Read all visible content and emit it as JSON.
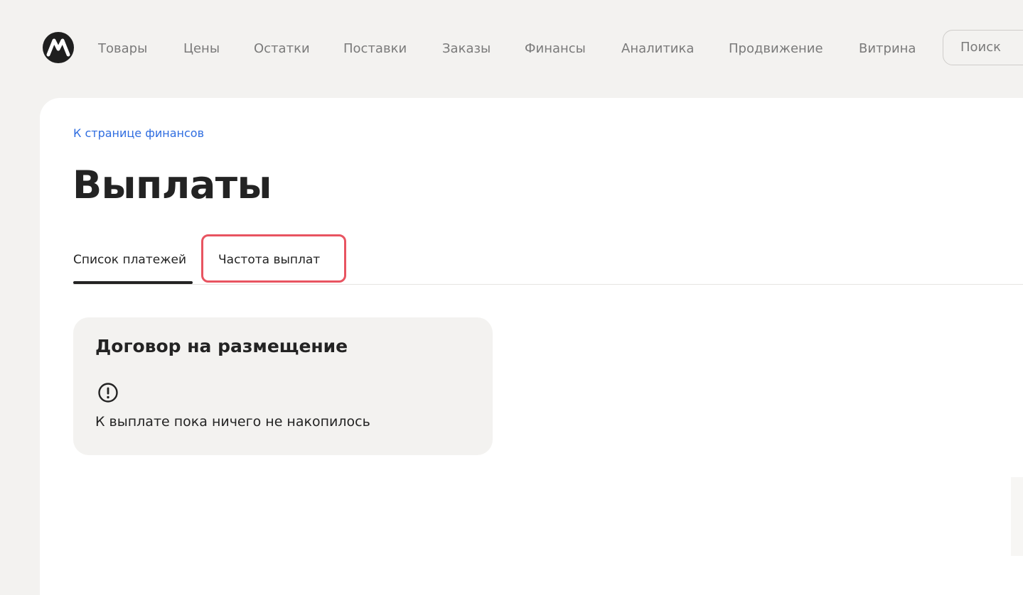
{
  "nav": {
    "items": [
      {
        "label": "Товары"
      },
      {
        "label": "Цены"
      },
      {
        "label": "Остатки"
      },
      {
        "label": "Поставки"
      },
      {
        "label": "Заказы"
      },
      {
        "label": "Финансы"
      },
      {
        "label": "Аналитика"
      },
      {
        "label": "Продвижение"
      },
      {
        "label": "Витрина"
      }
    ],
    "search_label": "Поиск"
  },
  "content": {
    "back_link": "К странице финансов",
    "title": "Выплаты",
    "tabs": [
      {
        "label": "Список платежей",
        "active": true
      },
      {
        "label": "Частота выплат",
        "active": false
      }
    ],
    "panel": {
      "title": "Договор на размещение",
      "message": "К выплате пока ничего не накопилось"
    }
  },
  "colors": {
    "link": "#2f6de0",
    "highlight": "#e85461",
    "page_bg": "#f3f2f0"
  },
  "icons": {
    "logo": "market-logo",
    "alert": "exclamation-circle-icon"
  }
}
